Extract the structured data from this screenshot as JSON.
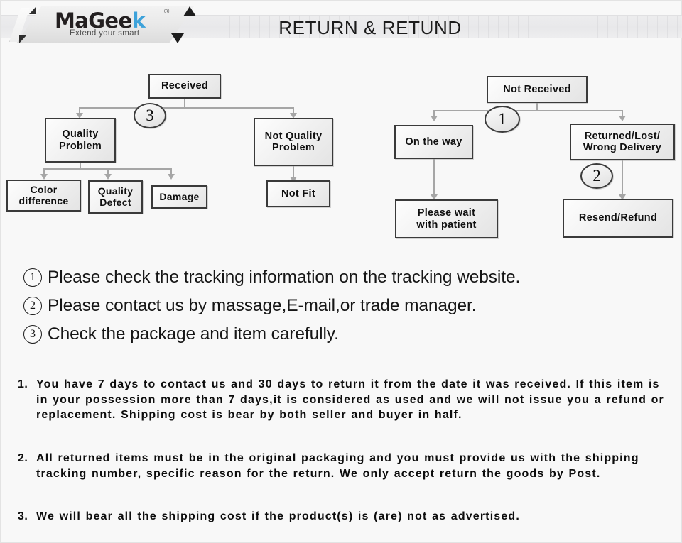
{
  "header": {
    "title": "RETURN & RETUND",
    "logo": {
      "brand_prefix": "MaGee",
      "brand_accent_letter": "k",
      "registered_mark": "®",
      "tagline": "Extend your smart",
      "accent_color": "#3da2da",
      "text_color": "#231f20"
    }
  },
  "flowchart": {
    "received_branch": {
      "root": "Received",
      "marker": "3",
      "children": [
        {
          "label_line1": "Quality",
          "label_line2": "Problem",
          "children": [
            {
              "label_line1": "Color",
              "label_line2": "difference"
            },
            {
              "label_line1": "Quality",
              "label_line2": "Defect"
            },
            {
              "label_line1": "Damage",
              "label_line2": ""
            }
          ]
        },
        {
          "label_line1": "Not Quality",
          "label_line2": "Problem",
          "children": [
            {
              "label_line1": "Not Fit",
              "label_line2": ""
            }
          ]
        }
      ]
    },
    "not_received_branch": {
      "root": "Not  Received",
      "marker": "1",
      "children": [
        {
          "label_line1": "On the way",
          "label_line2": "",
          "children": [
            {
              "label_line1": "Please wait",
              "label_line2": "with patient"
            }
          ]
        },
        {
          "label_line1": "Returned/Lost/",
          "label_line2": "Wrong Delivery",
          "marker": "2",
          "children": [
            {
              "label_line1": "Resend/Refund",
              "label_line2": ""
            }
          ]
        }
      ]
    }
  },
  "legend": [
    {
      "num": "1",
      "text": "Please check the tracking information on the tracking website."
    },
    {
      "num": "2",
      "text": "Please contact us by  massage,E-mail,or trade manager."
    },
    {
      "num": "3",
      "text": "Check the package and item carefully."
    }
  ],
  "terms": [
    {
      "num": "1.",
      "text": "You have 7 days to contact us and 30 days to return it from the date it was received. If this item is in your possession more than 7 days,it is considered as used and we will not issue you a refund or replacement. Shipping cost is bear by both seller and buyer in half."
    },
    {
      "num": "2.",
      "text": "All returned items must be in the original packaging and you must provide us with the shipping tracking number, specific reason for the return. We only accept return the goods by Post."
    },
    {
      "num": "3.",
      "text": "We will bear all the shipping cost if the product(s) is (are) not as advertised."
    }
  ]
}
